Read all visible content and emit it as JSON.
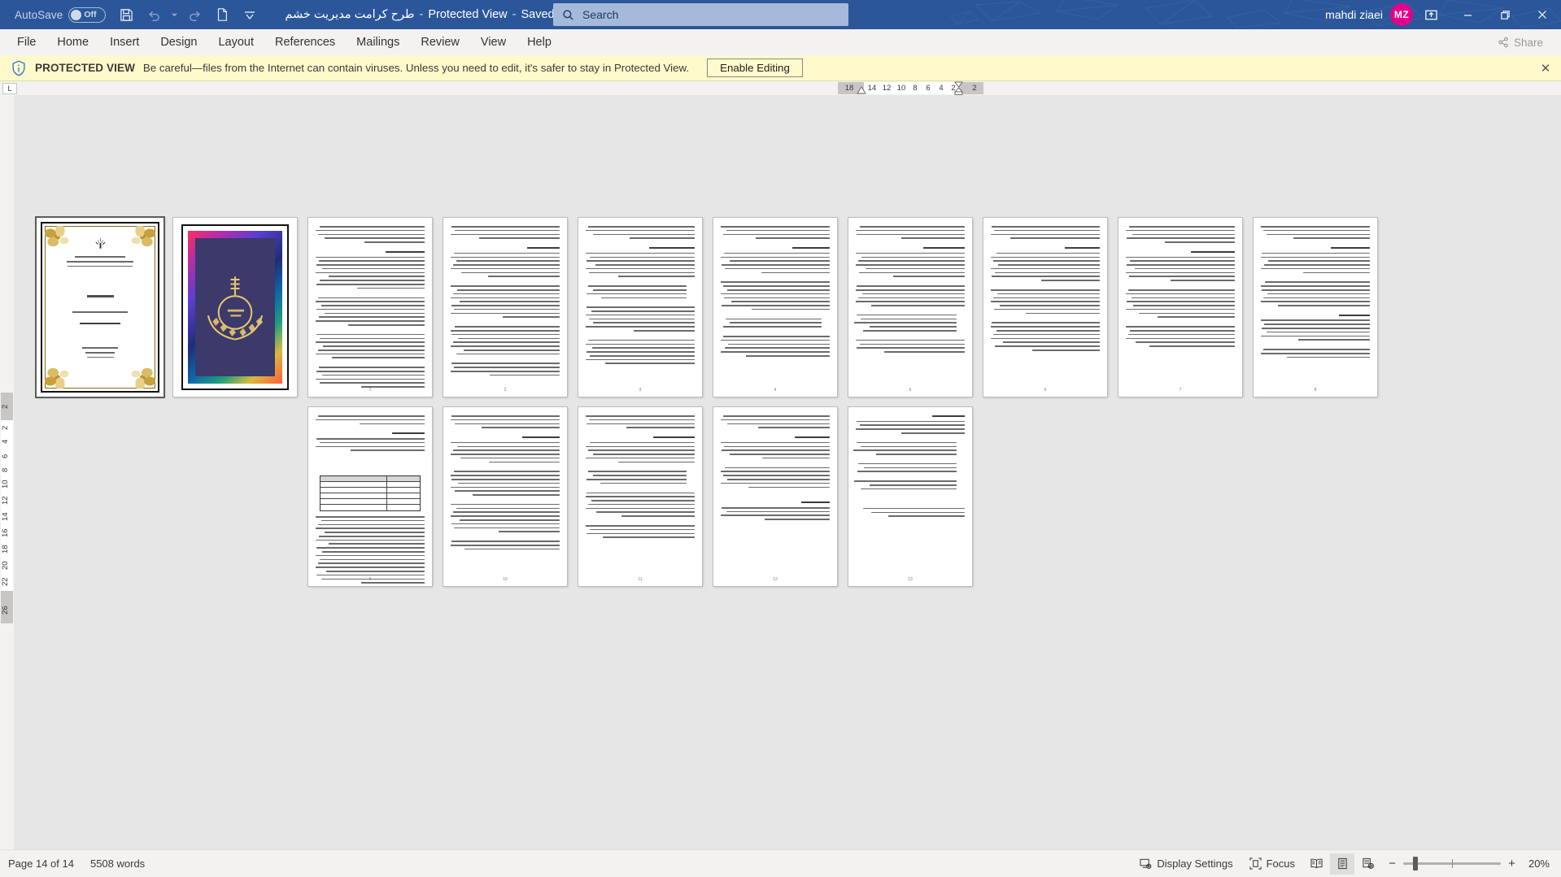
{
  "titlebar": {
    "autosave_label": "AutoSave",
    "autosave_state": "Off",
    "quick_access": [
      {
        "name": "save-icon",
        "tooltip": "Save"
      },
      {
        "name": "undo-icon",
        "tooltip": "Undo"
      },
      {
        "name": "undo-dropdown-icon",
        "tooltip": "Undo options"
      },
      {
        "name": "redo-icon",
        "tooltip": "Redo"
      },
      {
        "name": "new-document-icon",
        "tooltip": "New"
      },
      {
        "name": "customize-quick-access-toolbar-icon",
        "tooltip": "Customize Quick Access Toolbar"
      }
    ],
    "doc_title": "طرح کرامت مدیریت خشم",
    "separator": "-",
    "protected_view_label": "Protected View",
    "save_location": "Saved to this PC",
    "user_name": "mahdi ziaei",
    "avatar_initials": "MZ",
    "window_buttons": {
      "ribbon_display_options": "ribbon-display-options-icon",
      "minimize": "minimize-icon",
      "restore": "restore-icon",
      "close": "close-icon"
    }
  },
  "search": {
    "placeholder": "Search",
    "icon": "search-icon"
  },
  "ribbon": {
    "tabs": [
      {
        "label": "File"
      },
      {
        "label": "Home"
      },
      {
        "label": "Insert"
      },
      {
        "label": "Design"
      },
      {
        "label": "Layout"
      },
      {
        "label": "References"
      },
      {
        "label": "Mailings"
      },
      {
        "label": "Review"
      },
      {
        "label": "View"
      },
      {
        "label": "Help"
      }
    ],
    "share_label": "Share",
    "share_icon": "share-icon"
  },
  "protected_view": {
    "icon": "shield-info-icon",
    "title": "PROTECTED VIEW",
    "message": "Be careful—files from the Internet can contain viruses. Unless you need to edit, it's safer to stay in Protected View.",
    "button_label": "Enable Editing",
    "close_icon": "close-icon",
    "bar_color": "#fff9cc"
  },
  "horizontal_ruler": {
    "tab_stop_marker": "L",
    "numbers": [
      "18",
      "14",
      "12",
      "10",
      "8",
      "6",
      "4",
      "2",
      "2"
    ]
  },
  "vertical_ruler": {
    "numbers": [
      "2",
      "2",
      "4",
      "6",
      "8",
      "10",
      "12",
      "14",
      "16",
      "18",
      "20",
      "22",
      "26"
    ]
  },
  "document": {
    "zoom_percent": "20%",
    "pages_total": 14,
    "row1_pages": [
      {
        "index": 1,
        "type": "cover",
        "cover": {
          "emblem_icon": "iran-emblem-icon",
          "org_lines": [
            "بسمه تعالی",
            "اداره کل آموزش و پرورش استان ...",
            "اداره آموزش و پرورش شهرستان ..."
          ],
          "heading": "عنوان :",
          "subject_label": "گزارش طرح کرامت با موضوع",
          "subject_value": "آموزش واحدهای مدیریت خشم",
          "meta_lines": [
            "نام و نام خانوادگی :",
            "نام آموزشگاه :",
            "سال تحصیلی :"
          ]
        },
        "page_label": ""
      },
      {
        "index": 2,
        "type": "art",
        "art": {
          "calligraphy": "بسم الله الرحمن الرحیم",
          "bg_color": "#3b3a6b"
        },
        "page_label": ""
      },
      {
        "index": 3,
        "type": "text",
        "lines": 44,
        "page_label": "1"
      },
      {
        "index": 4,
        "type": "text",
        "lines": 44,
        "page_label": "2"
      },
      {
        "index": 5,
        "type": "text",
        "lines": 44,
        "page_label": "3"
      },
      {
        "index": 6,
        "type": "text",
        "lines": 44,
        "page_label": "4"
      },
      {
        "index": 7,
        "type": "text",
        "lines": 44,
        "page_label": "5"
      },
      {
        "index": 8,
        "type": "text",
        "lines": 44,
        "page_label": "6"
      },
      {
        "index": 9,
        "type": "text",
        "lines": 44,
        "page_label": "7"
      },
      {
        "index": 10,
        "type": "text",
        "lines": 44,
        "page_label": "8"
      }
    ],
    "row2_pages": [
      {
        "index": 11,
        "type": "text-table",
        "lines": 44,
        "page_label": "9"
      },
      {
        "index": 12,
        "type": "text",
        "lines": 44,
        "page_label": "10"
      },
      {
        "index": 13,
        "type": "text",
        "lines": 44,
        "page_label": "11"
      },
      {
        "index": 14,
        "type": "text",
        "lines": 40,
        "page_label": "12"
      },
      {
        "index": 15,
        "type": "text-refs",
        "lines": 30,
        "page_label": "13"
      }
    ]
  },
  "statusbar": {
    "page_indicator": "Page 14 of 14",
    "word_count": "5508 words",
    "display_settings_label": "Display Settings",
    "display_settings_icon": "display-settings-icon",
    "focus_label": "Focus",
    "focus_icon": "focus-icon",
    "view_buttons": [
      {
        "name": "read-mode-icon",
        "active": false
      },
      {
        "name": "print-layout-icon",
        "active": true
      },
      {
        "name": "web-layout-icon",
        "active": false
      }
    ],
    "zoom": {
      "minus": "−",
      "plus": "+",
      "percent": "20%",
      "thumb_position_pct": 10
    }
  },
  "colors": {
    "title_bar": "#2b579a",
    "ribbon_bg": "#f3f2f1",
    "protected_bar": "#fff9cc",
    "canvas_bg": "#e6e6e6",
    "accent_avatar": "#e3008c"
  }
}
